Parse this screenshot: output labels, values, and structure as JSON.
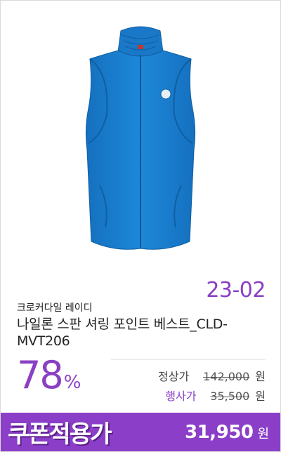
{
  "product": {
    "code": "23-02",
    "brand": "크로커다일 레이디",
    "title": "나일론 스판 셔링 포인트 베스트_CLD-MVT206",
    "image_icon": "blue-vest-image"
  },
  "discount": {
    "value": "78",
    "percent_sign": "%"
  },
  "prices": {
    "normal_label": "정상가",
    "normal_value": "142,000",
    "event_label": "행사가",
    "event_value": "35,500",
    "currency": "원"
  },
  "coupon": {
    "label": "쿠폰적용가",
    "value": "31,950",
    "currency": "원"
  },
  "colors": {
    "accent": "#8a3fc4",
    "vest": "#1a7fd0"
  }
}
